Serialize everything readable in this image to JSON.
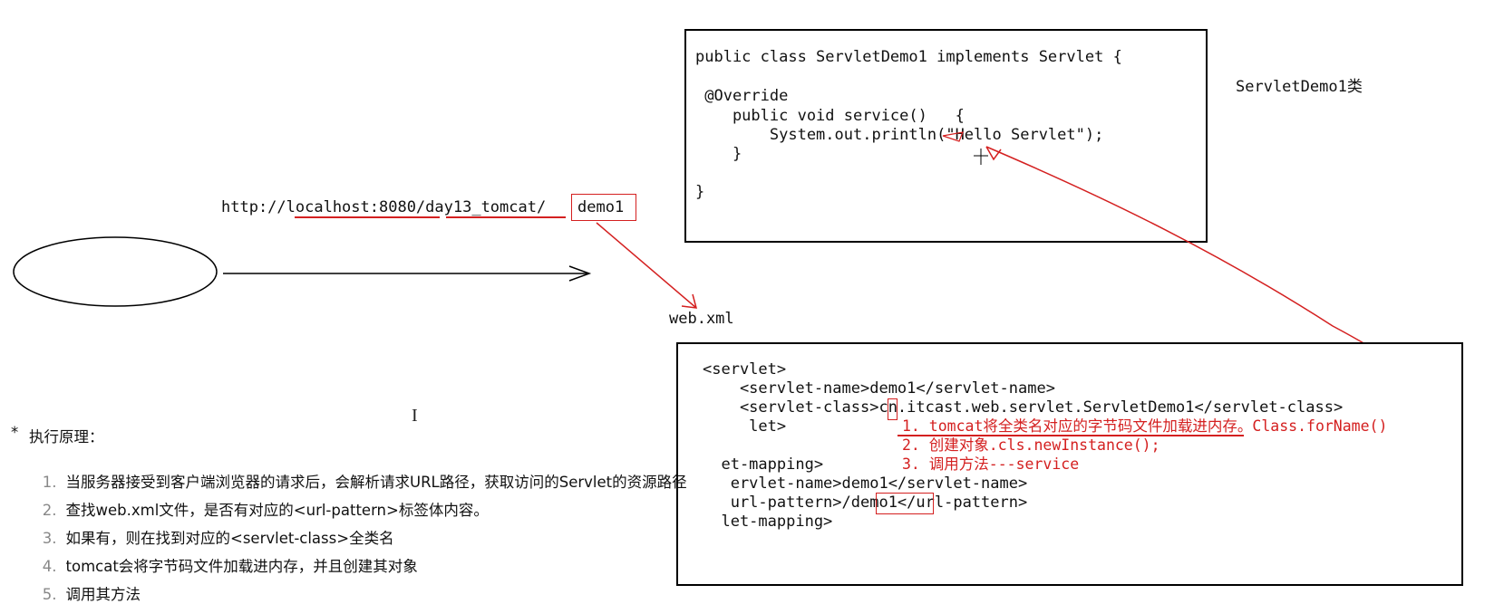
{
  "servlet_code": {
    "lines": [
      "public class ServletDemo1 implements Servlet {",
      "",
      " @Override",
      "    public void service()   {",
      "        System.out.println(\"Hello Servlet\");",
      "    }",
      "",
      "}"
    ],
    "caption": "ServletDemo1类"
  },
  "url": {
    "base": "http://localhost:8080/day13_tomcat/",
    "resource": "demo1"
  },
  "web_xml_label": "web.xml",
  "web_xml": {
    "lines": [
      "<servlet>",
      "    <servlet-name>demo1</servlet-name>",
      "    <servlet-class>cn.itcast.web.servlet.ServletDemo1</servlet-class>",
      "     let>",
      "",
      "  et-mapping>",
      "   ervlet-name>demo1</servlet-name>",
      "   url-pattern>/demo1</url-pattern>",
      "  let-mapping>"
    ]
  },
  "steps_overlay": [
    "1. tomcat将全类名对应的字节码文件加载进内存。Class.forName()",
    "2. 创建对象.cls.newInstance();",
    "3. 调用方法---service"
  ],
  "principle": {
    "heading": "执行原理：",
    "bullet": "*",
    "items": [
      {
        "num": "1.",
        "text": "当服务器接受到客户端浏览器的请求后，会解析请求URL路径，获取访问的Servlet的资源路径"
      },
      {
        "num": "2.",
        "text": "查找web.xml文件，是否有对应的<url-pattern>标签体内容。"
      },
      {
        "num": "3.",
        "text": "如果有，则在找到对应的<servlet-class>全类名"
      },
      {
        "num": "4.",
        "text": "tomcat会将字节码文件加载进内存，并且创建其对象"
      },
      {
        "num": "5.",
        "text": "调用其方法"
      }
    ]
  },
  "colors": {
    "annotation": "#d42020",
    "border": "#000000"
  }
}
